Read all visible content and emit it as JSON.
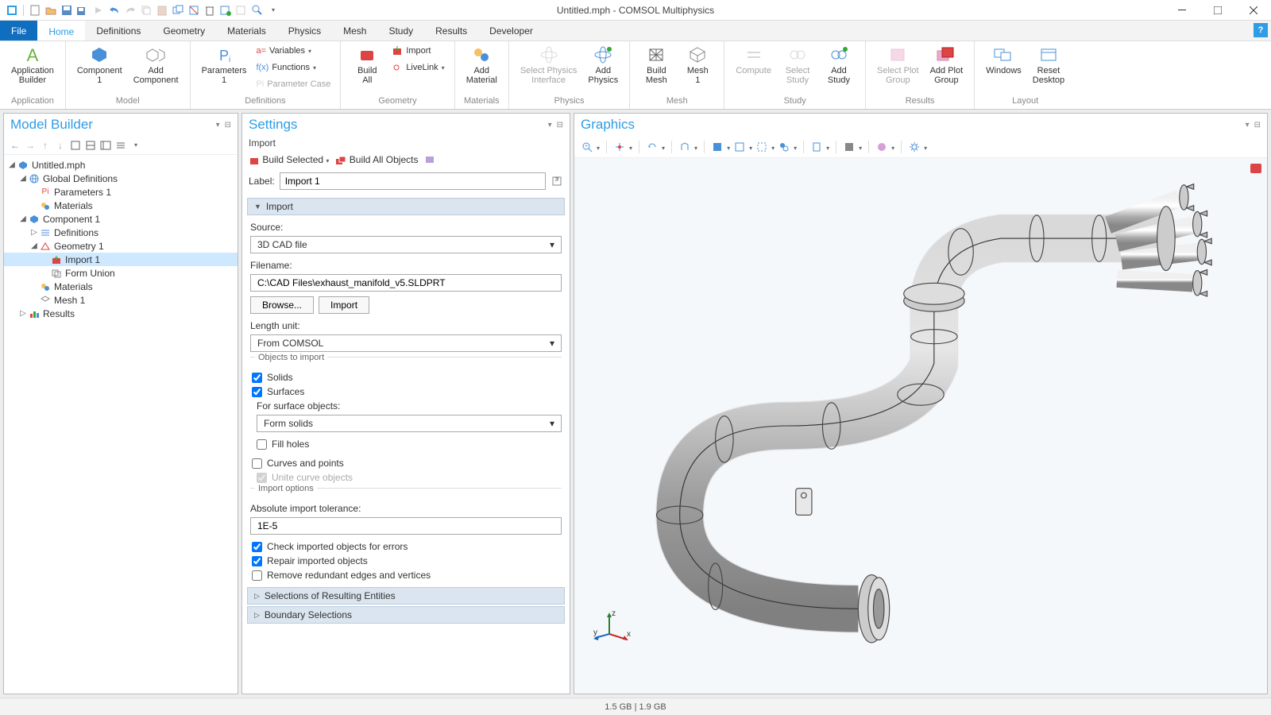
{
  "window": {
    "title": "Untitled.mph - COMSOL Multiphysics"
  },
  "ribbon_tabs": {
    "file": "File",
    "home": "Home",
    "definitions": "Definitions",
    "geometry": "Geometry",
    "materials": "Materials",
    "physics": "Physics",
    "mesh": "Mesh",
    "study": "Study",
    "results": "Results",
    "developer": "Developer"
  },
  "ribbon": {
    "application": {
      "label": "Application",
      "app_builder": "Application\nBuilder"
    },
    "model": {
      "label": "Model",
      "component": "Component\n1",
      "add_component": "Add\nComponent"
    },
    "definitions": {
      "label": "Definitions",
      "parameters": "Parameters\n1",
      "variables": "Variables",
      "functions": "Functions",
      "parameter_case": "Parameter Case"
    },
    "geometry": {
      "label": "Geometry",
      "build_all": "Build\nAll",
      "import": "Import",
      "livelink": "LiveLink"
    },
    "materials": {
      "label": "Materials",
      "add_material": "Add\nMaterial"
    },
    "physics": {
      "label": "Physics",
      "select_physics": "Select Physics\nInterface",
      "add_physics": "Add\nPhysics"
    },
    "mesh": {
      "label": "Mesh",
      "build_mesh": "Build\nMesh",
      "mesh1": "Mesh\n1"
    },
    "study": {
      "label": "Study",
      "compute": "Compute",
      "select_study": "Select\nStudy",
      "add_study": "Add\nStudy"
    },
    "results": {
      "label": "Results",
      "select_plot": "Select Plot\nGroup",
      "add_plot": "Add Plot\nGroup"
    },
    "layout": {
      "label": "Layout",
      "windows": "Windows",
      "reset_desktop": "Reset\nDesktop"
    }
  },
  "model_builder": {
    "title": "Model Builder",
    "tree": {
      "root": "Untitled.mph",
      "global_defs": "Global Definitions",
      "parameters1": "Parameters 1",
      "materials_g": "Materials",
      "component1": "Component 1",
      "definitions": "Definitions",
      "geometry1": "Geometry 1",
      "import1": "Import 1",
      "form_union": "Form Union",
      "materials_c": "Materials",
      "mesh1": "Mesh 1",
      "results": "Results"
    }
  },
  "settings": {
    "title": "Settings",
    "subheader": "Import",
    "build_selected": "Build Selected",
    "build_all": "Build All Objects",
    "label_label": "Label:",
    "label_value": "Import 1",
    "sections": {
      "import": "Import",
      "selections": "Selections of Resulting Entities",
      "boundary": "Boundary Selections"
    },
    "source_label": "Source:",
    "source_value": "3D CAD file",
    "filename_label": "Filename:",
    "filename_value": "C:\\CAD Files\\exhaust_manifold_v5.SLDPRT",
    "browse": "Browse...",
    "import_btn": "Import",
    "length_unit_label": "Length unit:",
    "length_unit_value": "From COMSOL",
    "objects_to_import": "Objects to import",
    "solids": "Solids",
    "surfaces": "Surfaces",
    "surface_objects_label": "For surface objects:",
    "surface_objects_value": "Form solids",
    "fill_holes": "Fill holes",
    "curves_points": "Curves and points",
    "unite_curves": "Unite curve objects",
    "import_options": "Import options",
    "tolerance_label": "Absolute import tolerance:",
    "tolerance_value": "1E-5",
    "check_errors": "Check imported objects for errors",
    "repair": "Repair imported objects",
    "remove_redundant": "Remove redundant edges and vertices"
  },
  "graphics": {
    "title": "Graphics"
  },
  "status": {
    "memory": "1.5 GB | 1.9 GB"
  }
}
